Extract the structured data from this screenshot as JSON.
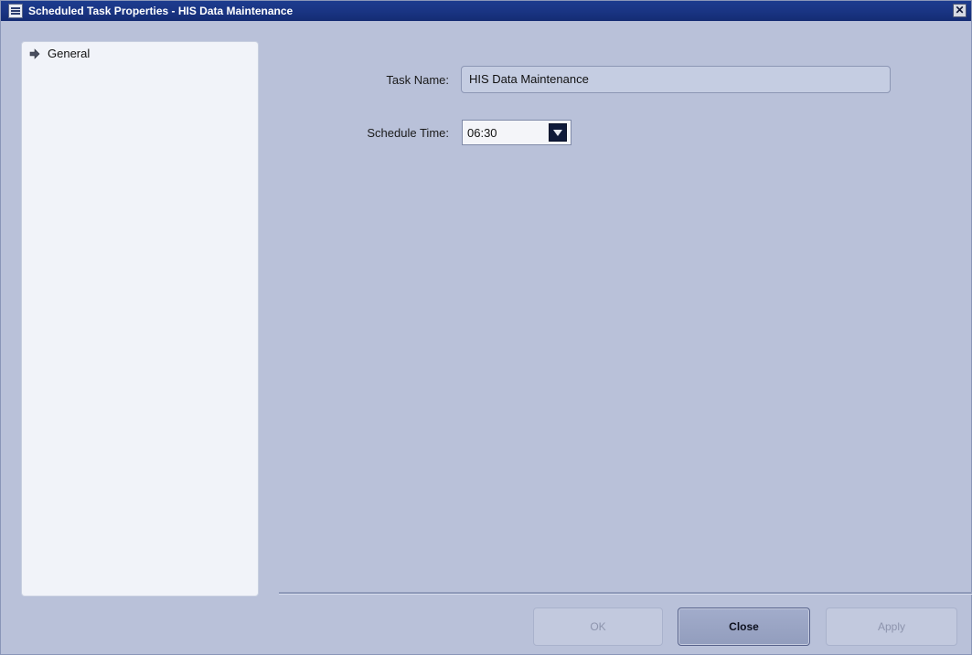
{
  "window": {
    "title": "Scheduled Task Properties - HIS Data Maintenance",
    "close_glyph": "✕"
  },
  "sidebar": {
    "items": [
      {
        "label": "General",
        "icon": "arrow-right-icon",
        "selected": true
      }
    ]
  },
  "form": {
    "task_name_label": "Task Name:",
    "task_name_value": "HIS Data Maintenance",
    "schedule_time_label": "Schedule Time:",
    "schedule_time_value": "06:30"
  },
  "buttons": {
    "ok_label": "OK",
    "close_label": "Close",
    "apply_label": "Apply"
  },
  "colors": {
    "titlebar": "#1a3584",
    "panel_background": "#b9c1d9",
    "sidebar_background": "#f1f3f9"
  }
}
